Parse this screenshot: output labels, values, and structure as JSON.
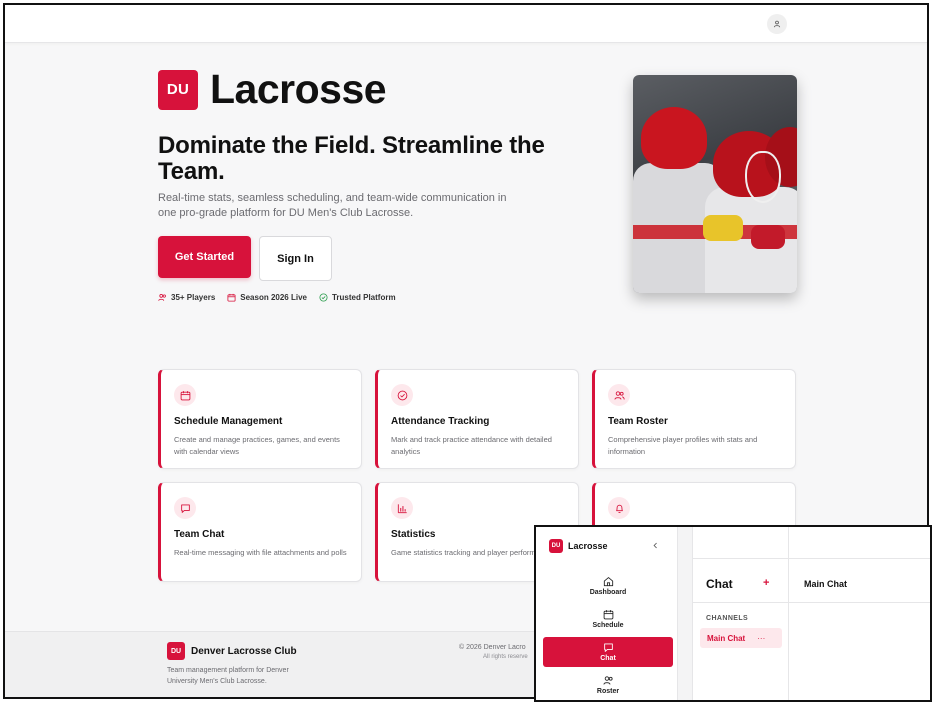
{
  "header": {
    "user_icon": "user-icon"
  },
  "brand": {
    "logo": "DU",
    "name": "Lacrosse"
  },
  "hero": {
    "headline": "Dominate the Field. Streamline the Team.",
    "subtext": "Real-time stats, seamless scheduling, and team-wide communication in one pro-grade platform for DU Men's Club Lacrosse.",
    "primary_button": "Get Started",
    "secondary_button": "Sign In",
    "stats": [
      {
        "icon": "users-icon",
        "label": "35+ Players"
      },
      {
        "icon": "calendar-icon",
        "label": "Season 2026 Live"
      },
      {
        "icon": "check-circle-icon",
        "label": "Trusted Platform"
      }
    ]
  },
  "features": [
    {
      "icon": "calendar-icon",
      "title": "Schedule Management",
      "description": "Create and manage practices, games, and events with calendar views"
    },
    {
      "icon": "check-circle-icon",
      "title": "Attendance Tracking",
      "description": "Mark and track practice attendance with detailed analytics"
    },
    {
      "icon": "users-icon",
      "title": "Team Roster",
      "description": "Comprehensive player profiles with stats and information"
    },
    {
      "icon": "message-icon",
      "title": "Team Chat",
      "description": "Real-time messaging with file attachments and polls"
    },
    {
      "icon": "bar-chart-icon",
      "title": "Statistics",
      "description": "Game statistics tracking and player perform metrics"
    },
    {
      "icon": "bell-icon",
      "title": "",
      "description": ""
    }
  ],
  "footer": {
    "logo": "DU",
    "name": "Denver Lacrosse Club",
    "description": "Team management platform for Denver University Men's Club Lacrosse.",
    "copyright": "© 2026 Denver Lacro",
    "rights": "All rights reserve"
  },
  "overlay": {
    "brand_logo": "DU",
    "brand_name": "Lacrosse",
    "nav": [
      {
        "icon": "home-icon",
        "label": "Dashboard"
      },
      {
        "icon": "calendar-icon",
        "label": "Schedule"
      },
      {
        "icon": "message-icon",
        "label": "Chat"
      },
      {
        "icon": "users-icon",
        "label": "Roster"
      }
    ],
    "chat": {
      "title": "Chat",
      "add": "+",
      "channels_label": "CHANNELS",
      "channel": "Main Chat",
      "channel_more": "···",
      "main_title": "Main Chat"
    }
  },
  "colors": {
    "accent": "#d7123b",
    "accent_light": "#fde8ec",
    "text": "#111111",
    "muted": "#6b6b70",
    "background": "#f7f7f8"
  }
}
